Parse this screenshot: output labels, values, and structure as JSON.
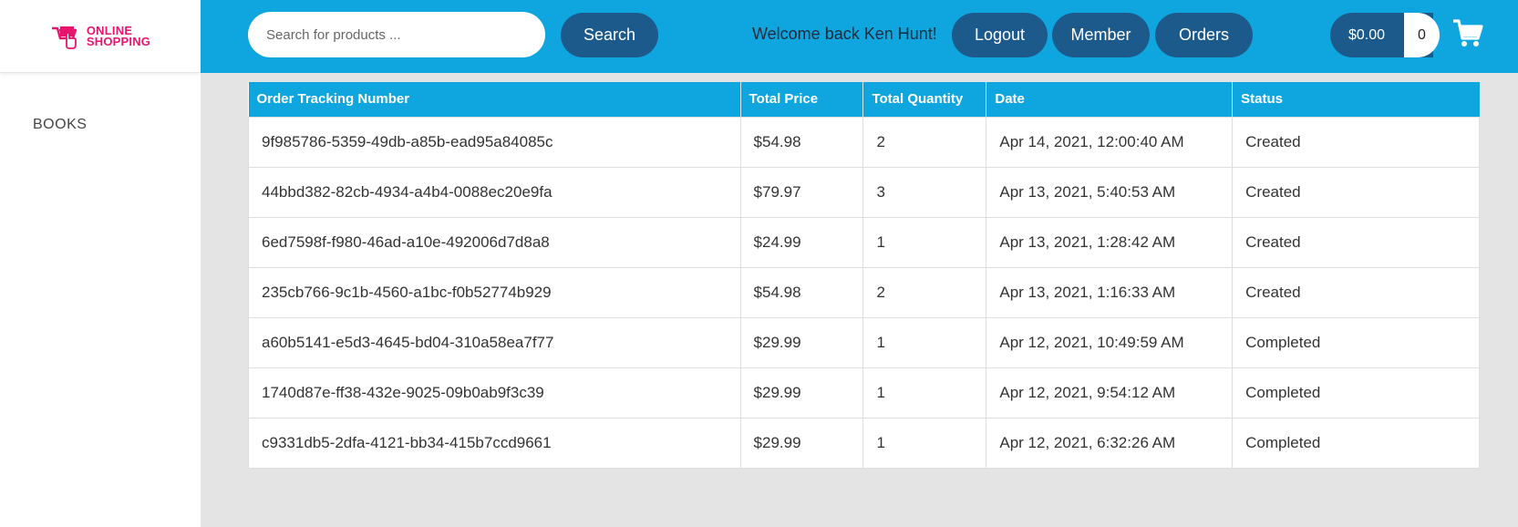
{
  "logo": {
    "line1": "ONLINE",
    "line2": "SHOPPING"
  },
  "sidebar": {
    "items": [
      {
        "label": "BOOKS"
      }
    ]
  },
  "header": {
    "search_placeholder": "Search for products ...",
    "search_label": "Search",
    "welcome": "Welcome back Ken Hunt!",
    "logout_label": "Logout",
    "member_label": "Member",
    "orders_label": "Orders",
    "cart_total": "$0.00",
    "cart_quantity": "0"
  },
  "orders": {
    "columns": [
      "Order Tracking Number",
      "Total Price",
      "Total Quantity",
      "Date",
      "Status"
    ],
    "rows": [
      [
        "9f985786-5359-49db-a85b-ead95a84085c",
        "$54.98",
        "2",
        "Apr 14, 2021, 12:00:40 AM",
        "Created"
      ],
      [
        "44bbd382-82cb-4934-a4b4-0088ec20e9fa",
        "$79.97",
        "3",
        "Apr 13, 2021, 5:40:53 AM",
        "Created"
      ],
      [
        "6ed7598f-f980-46ad-a10e-492006d7d8a8",
        "$24.99",
        "1",
        "Apr 13, 2021, 1:28:42 AM",
        "Created"
      ],
      [
        "235cb766-9c1b-4560-a1bc-f0b52774b929",
        "$54.98",
        "2",
        "Apr 13, 2021, 1:16:33 AM",
        "Created"
      ],
      [
        "a60b5141-e5d3-4645-bd04-310a58ea7f77",
        "$29.99",
        "1",
        "Apr 12, 2021, 10:49:59 AM",
        "Completed"
      ],
      [
        "1740d87e-ff38-432e-9025-09b0ab9f3c39",
        "$29.99",
        "1",
        "Apr 12, 2021, 9:54:12 AM",
        "Completed"
      ],
      [
        "c9331db5-2dfa-4121-bb34-415b7ccd9661",
        "$29.99",
        "1",
        "Apr 12, 2021, 6:32:26 AM",
        "Completed"
      ]
    ]
  },
  "colors": {
    "header_blue": "#0fa6e0",
    "button_navy": "#1d5a8c",
    "brand_pink": "#e8156e",
    "content_bg": "#e4e4e4"
  },
  "icons": {
    "logo": "shopping-cart-hand-icon",
    "cart": "shopping-cart-icon"
  }
}
